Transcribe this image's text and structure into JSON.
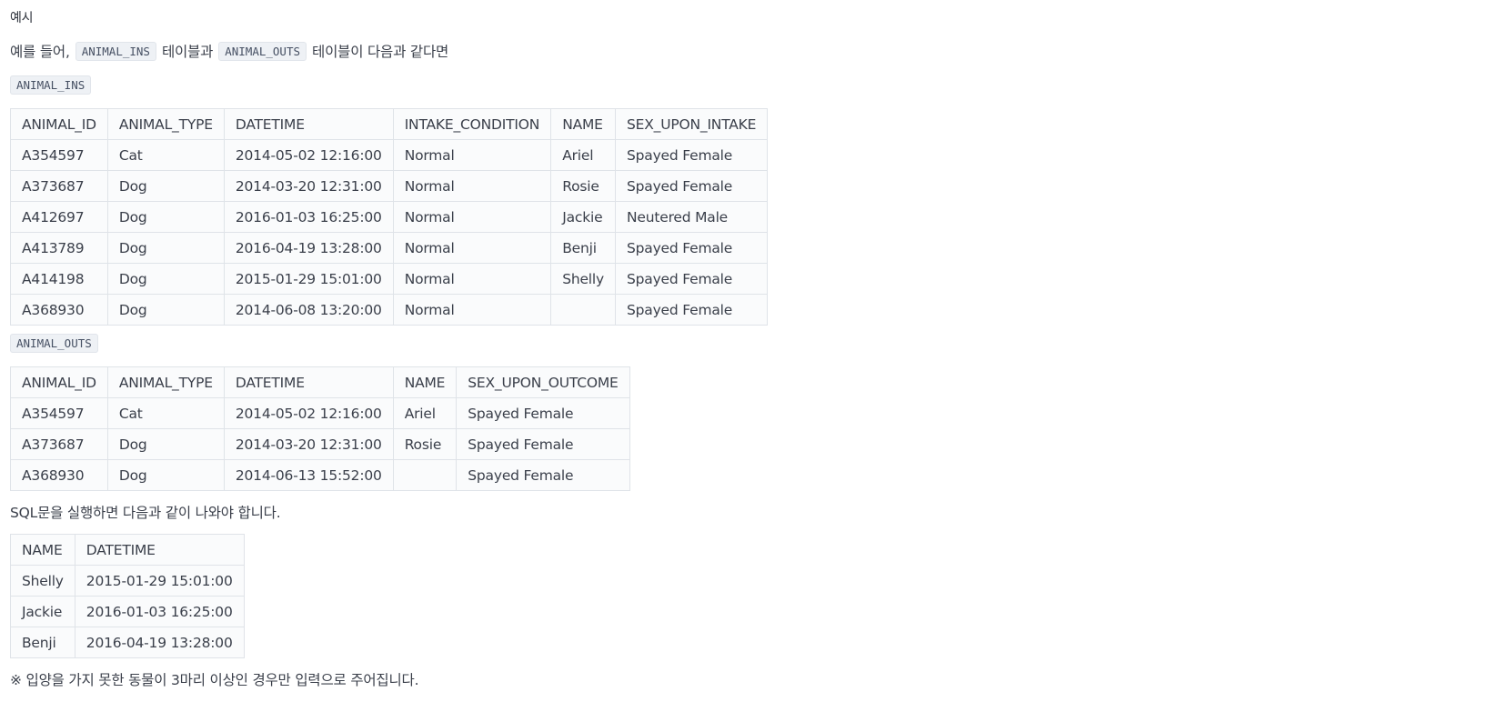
{
  "heading": "예시",
  "intro": {
    "prefix": "예를 들어,",
    "code1": "ANIMAL_INS",
    "mid": "테이블과",
    "code2": "ANIMAL_OUTS",
    "suffix": "테이블이 다음과 같다면"
  },
  "ins_label": "ANIMAL_INS",
  "ins_table": {
    "headers": [
      "ANIMAL_ID",
      "ANIMAL_TYPE",
      "DATETIME",
      "INTAKE_CONDITION",
      "NAME",
      "SEX_UPON_INTAKE"
    ],
    "rows": [
      [
        "A354597",
        "Cat",
        "2014-05-02 12:16:00",
        "Normal",
        "Ariel",
        "Spayed Female"
      ],
      [
        "A373687",
        "Dog",
        "2014-03-20 12:31:00",
        "Normal",
        "Rosie",
        "Spayed Female"
      ],
      [
        "A412697",
        "Dog",
        "2016-01-03 16:25:00",
        "Normal",
        "Jackie",
        "Neutered Male"
      ],
      [
        "A413789",
        "Dog",
        "2016-04-19 13:28:00",
        "Normal",
        "Benji",
        "Spayed Female"
      ],
      [
        "A414198",
        "Dog",
        "2015-01-29 15:01:00",
        "Normal",
        "Shelly",
        "Spayed Female"
      ],
      [
        "A368930",
        "Dog",
        "2014-06-08 13:20:00",
        "Normal",
        "",
        "Spayed Female"
      ]
    ]
  },
  "outs_label": "ANIMAL_OUTS",
  "outs_table": {
    "headers": [
      "ANIMAL_ID",
      "ANIMAL_TYPE",
      "DATETIME",
      "NAME",
      "SEX_UPON_OUTCOME"
    ],
    "rows": [
      [
        "A354597",
        "Cat",
        "2014-05-02 12:16:00",
        "Ariel",
        "Spayed Female"
      ],
      [
        "A373687",
        "Dog",
        "2014-03-20 12:31:00",
        "Rosie",
        "Spayed Female"
      ],
      [
        "A368930",
        "Dog",
        "2014-06-13 15:52:00",
        "",
        "Spayed Female"
      ]
    ]
  },
  "result_text": "SQL문을 실행하면 다음과 같이 나와야 합니다.",
  "result_table": {
    "headers": [
      "NAME",
      "DATETIME"
    ],
    "rows": [
      [
        "Shelly",
        "2015-01-29 15:01:00"
      ],
      [
        "Jackie",
        "2016-01-03 16:25:00"
      ],
      [
        "Benji",
        "2016-04-19 13:28:00"
      ]
    ]
  },
  "note": "※ 입양을 가지 못한 동물이 3마리 이상인 경우만 입력으로 주어집니다."
}
